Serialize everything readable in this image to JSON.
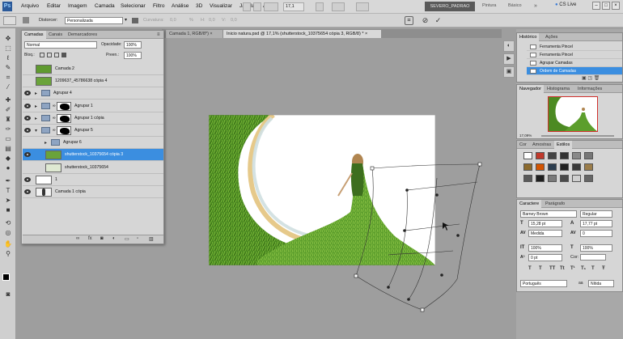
{
  "menu": {
    "logo": "Ps",
    "items": [
      "Arquivo",
      "Editar",
      "Imagem",
      "Camada",
      "Selecionar",
      "Filtro",
      "Análise",
      "3D",
      "Visualizar",
      "Janela",
      "Ajuda"
    ],
    "zoom": "17,1",
    "workspace_active": "SEVERO_PADRAO",
    "workspace_other": [
      "Pintura",
      "Básico"
    ],
    "cs_live": "CS Live"
  },
  "options": {
    "distort_label": "Distorcer:",
    "distort_value": "Personalizada",
    "curvature_label": "Curvatura:",
    "curvature_value": "0,0",
    "h_label": "H:",
    "h_value": "0,0",
    "v_label": "V:",
    "v_value": "0,0"
  },
  "document_tabs": [
    {
      "label": "Camada 1, RGB/8*) ×",
      "active": false
    },
    {
      "label": "Inicio natura.psd @ 17,1% (shutterstock_10375654 cópia 3, RGB/8) * ×",
      "active": true
    }
  ],
  "layers_panel": {
    "tabs": [
      "Camadas",
      "Canais",
      "Demarcadores"
    ],
    "blend_mode": "Normal",
    "opacity_label": "Opacidade:",
    "opacity_value": "100%",
    "lock_label": "Bloq.:",
    "fill_label": "Preen.:",
    "fill_value": "100%",
    "layers": [
      {
        "name": "Camada 2",
        "kind": "layer",
        "visible": false,
        "selected": false,
        "indent": 0
      },
      {
        "name": "1209637_45786638 cópia 4",
        "kind": "layer",
        "visible": false,
        "selected": false,
        "indent": 0
      },
      {
        "name": "Agrupar 4",
        "kind": "group",
        "visible": true,
        "selected": false,
        "indent": 0
      },
      {
        "name": "Agrupar 1",
        "kind": "group-mask",
        "visible": true,
        "selected": false,
        "indent": 0
      },
      {
        "name": "Agrupar 1 cópia",
        "kind": "group-mask",
        "visible": true,
        "selected": false,
        "indent": 0
      },
      {
        "name": "Agrupar 5",
        "kind": "group-mask-open",
        "visible": true,
        "selected": false,
        "indent": 0
      },
      {
        "name": "Agrupar 6",
        "kind": "group",
        "visible": false,
        "selected": false,
        "indent": 1
      },
      {
        "name": "shutterstock_10375654 cópia 3",
        "kind": "layer",
        "visible": true,
        "selected": true,
        "indent": 1
      },
      {
        "name": "shutterstock_10375654",
        "kind": "layer",
        "visible": false,
        "selected": false,
        "indent": 1
      },
      {
        "name": "1",
        "kind": "layer-white",
        "visible": true,
        "selected": false,
        "indent": 0
      },
      {
        "name": "Camada 1 cópia",
        "kind": "layer-figure",
        "visible": true,
        "selected": false,
        "indent": 0
      }
    ],
    "footer_icons": [
      "link-icon",
      "fx-icon",
      "mask-icon",
      "adjustment-icon",
      "folder-icon",
      "new-layer-icon",
      "trash-icon"
    ]
  },
  "history_panel": {
    "tabs": [
      "Histórico",
      "Ações"
    ],
    "items": [
      {
        "label": "Ferramenta Pincel",
        "selected": false
      },
      {
        "label": "Ferramenta Pincel",
        "selected": false
      },
      {
        "label": "Agrupar Camadas",
        "selected": false
      },
      {
        "label": "Ordem de Camadas",
        "selected": true
      }
    ]
  },
  "navigator_panel": {
    "tabs": [
      "Navegador",
      "Histograma",
      "Informações"
    ],
    "zoom": "17,09%"
  },
  "styles_panel": {
    "tabs": [
      "Cor",
      "Amostras",
      "Estilos"
    ],
    "swatches": [
      "#ffffff",
      "#c0392b",
      "#444444",
      "#333333",
      "#888888",
      "#777777",
      "#8c6b2e",
      "#d35400",
      "#2c3e50",
      "#222222",
      "#3a3a3a",
      "#9b7d4a",
      "#5a5a5a",
      "#1f1f1f",
      "#7a7a7a",
      "#4a4a4a",
      "#cfcfcf",
      "#666666"
    ]
  },
  "character_panel": {
    "tabs": [
      "Caractere",
      "Parágrafo"
    ],
    "font": "Barney Brown",
    "style": "Regular",
    "size": "15,28 pt",
    "leading": "17,77 pt",
    "kerning": "Medida",
    "tracking": "0",
    "v_scale": "100%",
    "h_scale": "100%",
    "baseline": "0 pt",
    "color_label": "Cor:",
    "glyph_buttons": [
      "T",
      "T",
      "TT",
      "Tt",
      "T¹",
      "T₁",
      "T",
      "Ŧ"
    ],
    "language": "Português",
    "aa_label": "aa",
    "aa_value": "Nítida"
  }
}
